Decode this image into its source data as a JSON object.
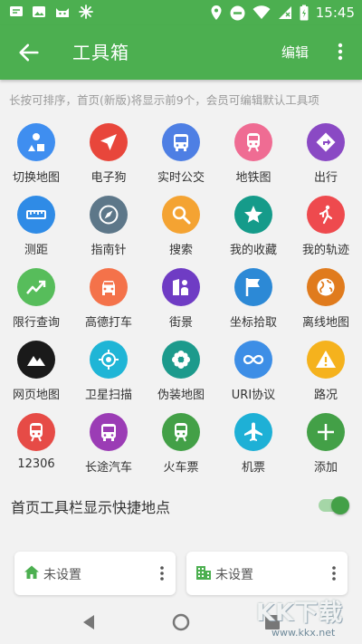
{
  "status_bar": {
    "time": "15:45"
  },
  "header": {
    "title": "工具箱",
    "edit_label": "编辑"
  },
  "hint": "长按可排序，首页(新版)将显示前9个，会员可编辑默认工具项",
  "tools": [
    {
      "label": "切换地图",
      "icon": "shapes-icon",
      "color": "#3f8ef0"
    },
    {
      "label": "电子狗",
      "icon": "navigation-arrow-icon",
      "color": "#e8463b"
    },
    {
      "label": "实时公交",
      "icon": "bus-icon",
      "color": "#4e7fe4"
    },
    {
      "label": "地铁图",
      "icon": "subway-icon",
      "color": "#ef6c93"
    },
    {
      "label": "出行",
      "icon": "directions-icon",
      "color": "#8a49c4"
    },
    {
      "label": "测距",
      "icon": "ruler-icon",
      "color": "#2f8be6"
    },
    {
      "label": "指南针",
      "icon": "compass-icon",
      "color": "#5d7789"
    },
    {
      "label": "搜索",
      "icon": "search-icon",
      "color": "#f4a332"
    },
    {
      "label": "我的收藏",
      "icon": "star-icon",
      "color": "#159b8a"
    },
    {
      "label": "我的轨迹",
      "icon": "walk-icon",
      "color": "#ee4a4e"
    },
    {
      "label": "限行查询",
      "icon": "trend-icon",
      "color": "#57bd5b"
    },
    {
      "label": "高德打车",
      "icon": "car-icon",
      "color": "#f4724a"
    },
    {
      "label": "街景",
      "icon": "streetview-icon",
      "color": "#6f3cc4"
    },
    {
      "label": "坐标拾取",
      "icon": "flag-icon",
      "color": "#2c89d6"
    },
    {
      "label": "离线地图",
      "icon": "globe-icon",
      "color": "#e07b1d"
    },
    {
      "label": "网页地图",
      "icon": "mountain-icon",
      "color": "#1a1a1a"
    },
    {
      "label": "卫星扫描",
      "icon": "gps-icon",
      "color": "#1fb5d6"
    },
    {
      "label": "伪装地图",
      "icon": "flower-icon",
      "color": "#1c9a8c"
    },
    {
      "label": "URI协议",
      "icon": "link-icon",
      "color": "#3d8ee6"
    },
    {
      "label": "路况",
      "icon": "warning-icon",
      "color": "#f5b21d"
    },
    {
      "label": "12306",
      "icon": "train-icon",
      "color": "#e64b46"
    },
    {
      "label": "长途汽车",
      "icon": "coach-icon",
      "color": "#9b3cb5"
    },
    {
      "label": "火车票",
      "icon": "train-ticket-icon",
      "color": "#43a047"
    },
    {
      "label": "机票",
      "icon": "airplane-icon",
      "color": "#1eb0d6"
    },
    {
      "label": "添加",
      "icon": "plus-icon",
      "color": "#43a047"
    }
  ],
  "pref": {
    "label": "首页工具栏显示快捷地点",
    "enabled": true
  },
  "shortcuts": [
    {
      "label": "未设置",
      "icon": "home-icon"
    },
    {
      "label": "未设置",
      "icon": "company-icon"
    }
  ],
  "watermark": {
    "brand": "KK下载",
    "url": "www.kkx.net"
  },
  "colors": {
    "primary": "#4caf50",
    "accent": "#43a047"
  }
}
